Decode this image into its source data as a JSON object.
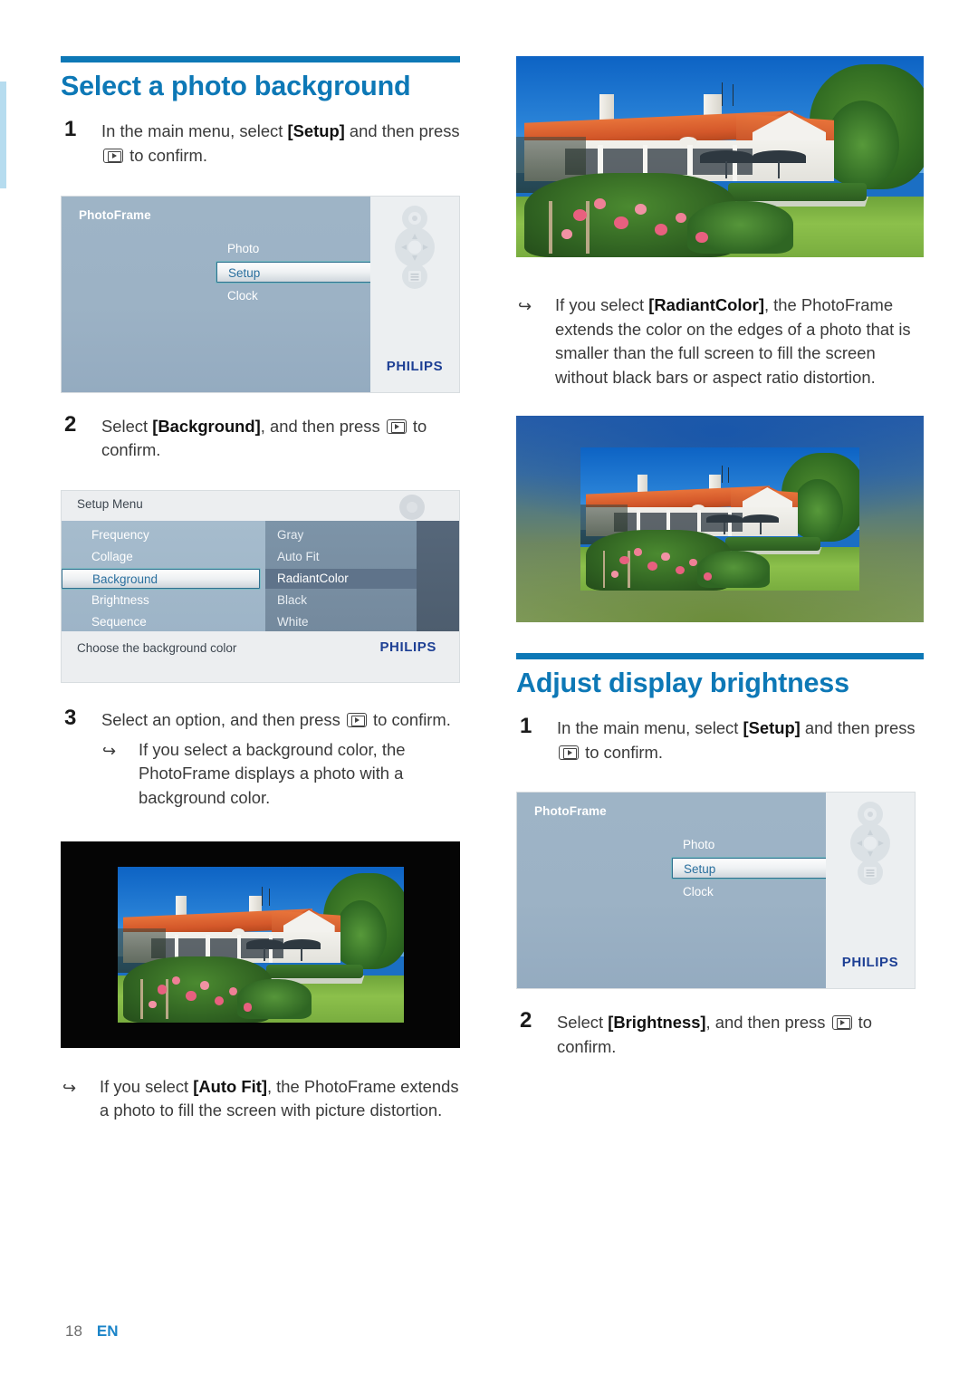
{
  "page": {
    "number": "18",
    "language": "EN"
  },
  "sections": {
    "background": {
      "heading": "Select a photo background",
      "steps": [
        {
          "num": "1",
          "text_before": "In the main menu, select ",
          "bold": "[Setup]",
          "text_after": " and then press ",
          "text_end": " to confirm."
        },
        {
          "num": "2",
          "text_before": "Select ",
          "bold": "[Background]",
          "text_after": ", and then press ",
          "text_end": " to confirm."
        },
        {
          "num": "3",
          "text_before": "Select an option, and then press ",
          "bold": "",
          "text_after": "",
          "text_end": " to confirm."
        }
      ],
      "bullets": [
        {
          "text_before": "If you select a background color, the PhotoFrame displays a photo with a background color.",
          "bold": "",
          "text_after": ""
        },
        {
          "text_before": "If you select ",
          "bold": "[Auto Fit]",
          "text_after": ", the PhotoFrame extends a photo to fill the screen with picture distortion."
        }
      ]
    },
    "radiant_bullet": {
      "text_before": "If you select ",
      "bold": "[RadiantColor]",
      "text_after": ", the PhotoFrame extends the color on the edges of a photo that is smaller than the full screen to fill the screen without black bars or aspect ratio distortion."
    },
    "brightness": {
      "heading": "Adjust display brightness",
      "steps": [
        {
          "num": "1",
          "text_before": "In the main menu, select ",
          "bold": "[Setup]",
          "text_after": " and then press ",
          "text_end": " to confirm."
        },
        {
          "num": "2",
          "text_before": "Select ",
          "bold": "[Brightness]",
          "text_after": ", and then press ",
          "text_end": " to confirm."
        }
      ]
    }
  },
  "photoframe_menu": {
    "title": "PhotoFrame",
    "items": [
      {
        "label": "Photo",
        "selected": false
      },
      {
        "label": "Setup",
        "selected": true
      },
      {
        "label": "Clock",
        "selected": false
      }
    ],
    "brand": "PHILIPS"
  },
  "setup_menu": {
    "title": "Setup Menu",
    "items": [
      {
        "label": "Frequency",
        "selected": false
      },
      {
        "label": "Collage",
        "selected": false
      },
      {
        "label": "Background",
        "selected": true
      },
      {
        "label": "Brightness",
        "selected": false
      },
      {
        "label": "Sequence",
        "selected": false
      }
    ],
    "options": [
      {
        "label": "Gray",
        "active": false
      },
      {
        "label": "Auto Fit",
        "active": false
      },
      {
        "label": "RadiantColor",
        "active": true
      },
      {
        "label": "Black",
        "active": false
      },
      {
        "label": "White",
        "active": false
      }
    ],
    "hint": "Choose the background color",
    "brand": "PHILIPS"
  },
  "colors": {
    "accent": "#0d78b6",
    "heading": "#0d78b6",
    "brand_blue": "#1d3f94",
    "edge_tab": "#b6dcef",
    "photo_background_black": "#050505"
  }
}
